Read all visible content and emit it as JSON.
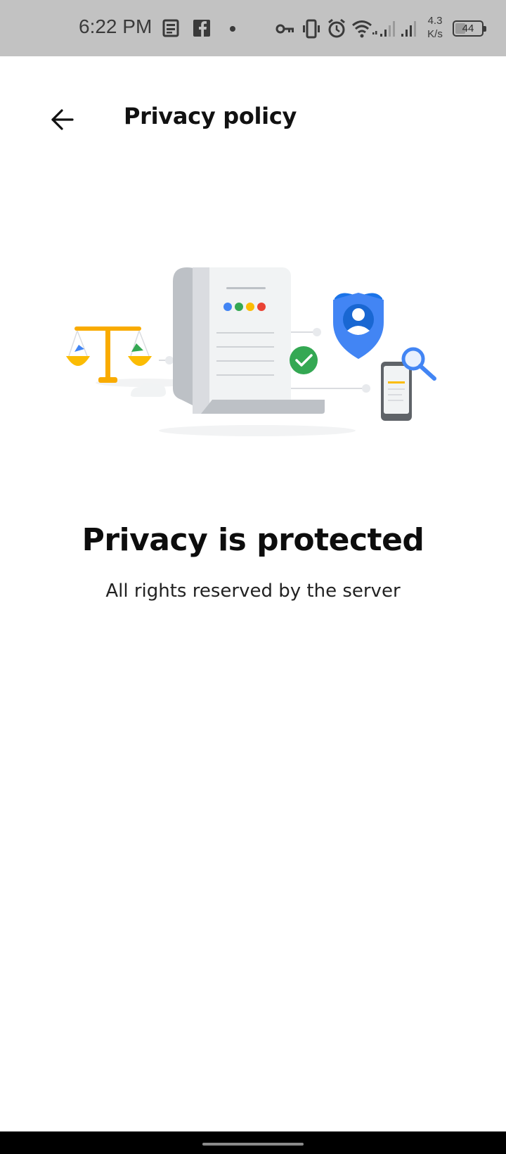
{
  "status_bar": {
    "time": "6:22 PM",
    "net_speed_value": "4.3",
    "net_speed_unit": "K/s",
    "battery_level": "44",
    "icons": [
      "news-icon",
      "facebook-icon",
      "notification-dot-icon",
      "vpn-key-icon",
      "vibrate-icon",
      "alarm-icon",
      "wifi-icon",
      "signal-icon",
      "signal-icon",
      "battery-icon"
    ]
  },
  "app_bar": {
    "back_icon": "arrow-back-icon",
    "title": "Privacy policy"
  },
  "main": {
    "illustration": "privacy-illustration",
    "headline": "Privacy is protected",
    "subtext": "All rights reserved by the server"
  },
  "colors": {
    "status_bar_bg": "#c2c2c2",
    "google_blue": "#4285F4",
    "google_green": "#34A853",
    "google_yellow": "#FBBC04",
    "google_red": "#EA4335",
    "shield_blue": "#3b78e7",
    "nav_bar": "#000000"
  }
}
